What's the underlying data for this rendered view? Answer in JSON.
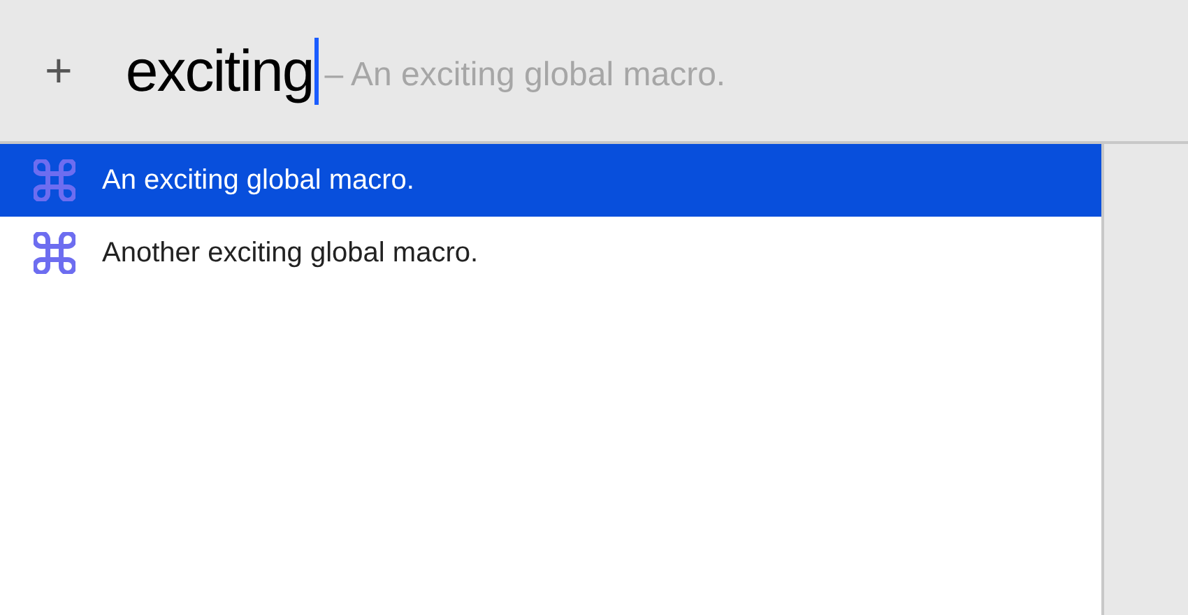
{
  "toolbar": {
    "add_button": "+",
    "search": {
      "value": "exciting",
      "completion": "– An exciting global macro."
    }
  },
  "results": [
    {
      "label": "An exciting global macro.",
      "selected": true
    },
    {
      "label": "Another exciting global macro.",
      "selected": false
    }
  ]
}
